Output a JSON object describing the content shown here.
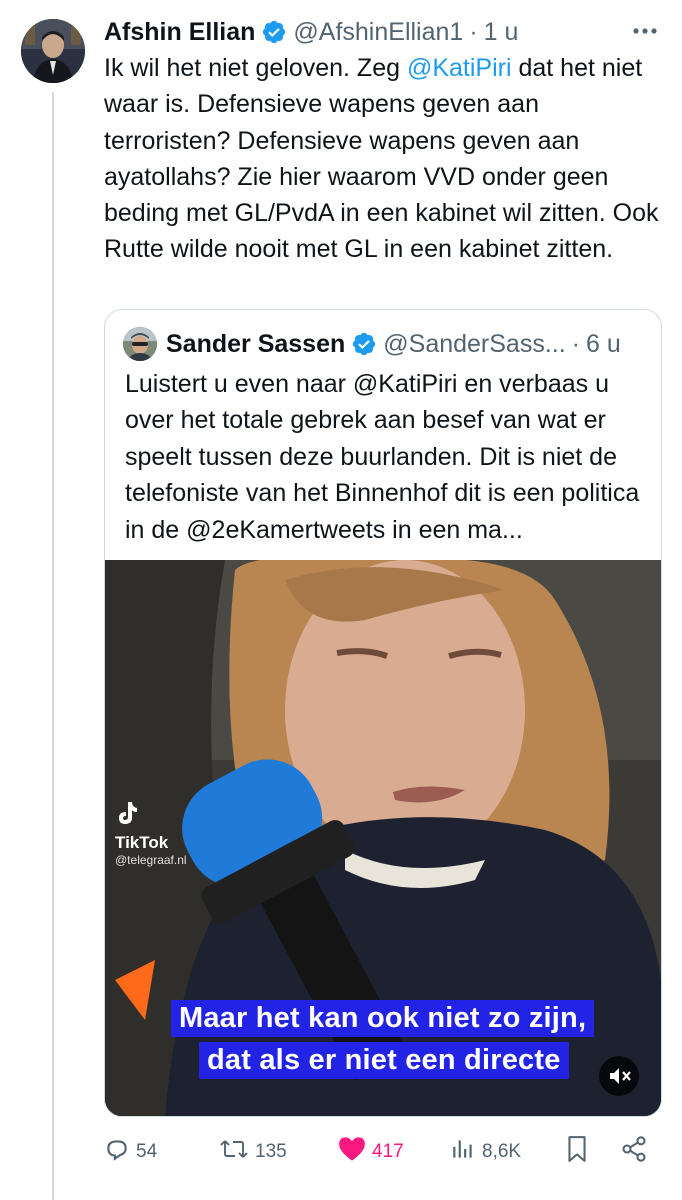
{
  "tweet": {
    "author_name": "Afshin Ellian",
    "handle": "@AfshinEllian1",
    "separator": "·",
    "time": "1 u",
    "text_part1": "Ik wil het niet geloven. Zeg ",
    "mention": "@KatiPiri",
    "text_part2": " dat het niet waar is. Defensieve wapens geven aan terroristen? Defensieve wapens geven aan ayatollahs? Zie hier waarom VVD onder geen beding met GL/PvdA in een kabinet wil zitten. Ook Rutte wilde nooit met GL in een kabinet zitten."
  },
  "quote": {
    "author_name": "Sander Sassen",
    "handle": "@SanderSass...",
    "separator": "·",
    "time": "6 u",
    "text": "Luistert u even naar @KatiPiri en verbaas u over het totale gebrek aan besef van wat er speelt tussen deze buurlanden. Dit is niet de telefoniste van het Binnenhof dit is een politica in de @2eKamertweets in een ma..."
  },
  "video": {
    "subtitle_line1": "Maar het kan ook niet zo zijn,",
    "subtitle_line2": "dat als er niet een directe",
    "watermark_name": "TikTok",
    "watermark_handle": "@telegraaf.nl"
  },
  "actions": {
    "replies": "54",
    "reposts": "135",
    "likes": "417",
    "views": "8,6K"
  },
  "colors": {
    "accent": "#1d9bf0",
    "like": "#f91880",
    "muted": "#536471",
    "subtitle_bg": "#2323e6"
  },
  "icons": [
    "more-icon",
    "verified-icon",
    "reply-icon",
    "repost-icon",
    "like-icon",
    "views-icon",
    "bookmark-icon",
    "share-icon",
    "mute-icon",
    "tiktok-icon"
  ]
}
